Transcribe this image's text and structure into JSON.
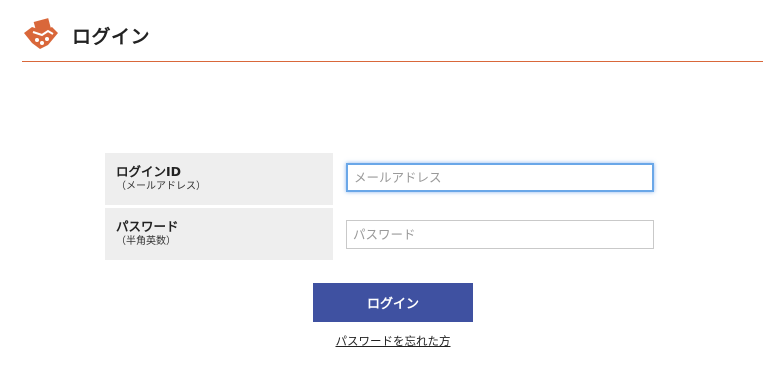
{
  "header": {
    "title": "ログイン",
    "logo_icon": "handshake-icon",
    "accent_color": "#d9673a"
  },
  "form": {
    "login_id": {
      "label": "ログインID",
      "sublabel": "（メールアドレス）",
      "placeholder": "メールアドレス",
      "value": ""
    },
    "password": {
      "label": "パスワード",
      "sublabel": "（半角英数）",
      "placeholder": "パスワード",
      "value": ""
    }
  },
  "actions": {
    "login_label": "ログイン",
    "login_color": "#3f51a1",
    "forgot_label": "パスワードを忘れた方"
  }
}
